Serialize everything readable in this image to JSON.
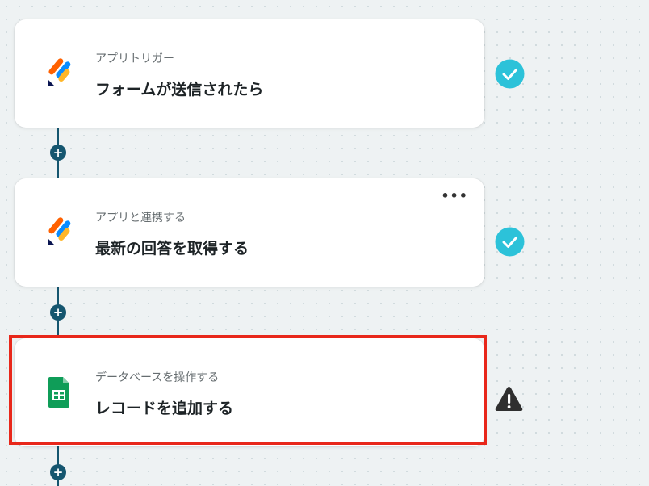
{
  "workflow": {
    "steps": [
      {
        "category": "アプリトリガー",
        "title": "フォームが送信されたら",
        "app_icon": "jotform-icon",
        "status": "check-icon",
        "status_color": "#2cc2d9"
      },
      {
        "category": "アプリと連携する",
        "title": "最新の回答を取得する",
        "app_icon": "jotform-icon",
        "status": "check-icon",
        "status_color": "#2cc2d9",
        "more_label": "•••"
      },
      {
        "category": "データベースを操作する",
        "title": "レコードを追加する",
        "app_icon": "google-sheets-icon",
        "status": "warning-icon",
        "status_color": "#2f2f2f",
        "highlight_color": "#e8271a"
      }
    ],
    "add_step_label": "+"
  }
}
